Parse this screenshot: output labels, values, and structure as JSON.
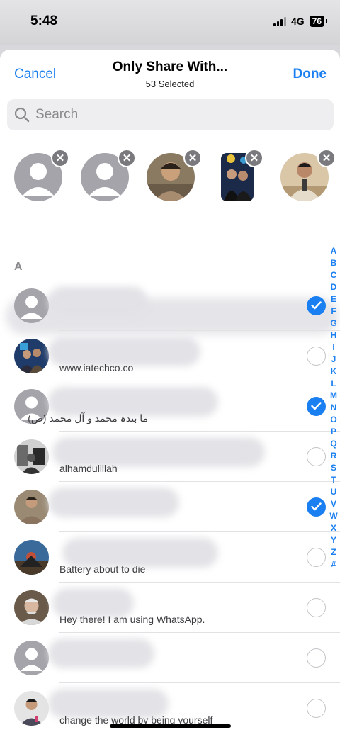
{
  "status_bar": {
    "time": "5:48",
    "network": "4G",
    "battery": "76"
  },
  "nav": {
    "cancel_label": "Cancel",
    "title": "Only Share With...",
    "subtitle": "53 Selected",
    "done_label": "Done"
  },
  "search": {
    "placeholder": "Search"
  },
  "selected_contacts": [
    {
      "avatar": "default-avatar"
    },
    {
      "avatar": "default-avatar"
    },
    {
      "avatar": "photo"
    },
    {
      "avatar": "photo"
    },
    {
      "avatar": "photo"
    }
  ],
  "section": {
    "letter": "A"
  },
  "contacts": [
    {
      "status": "",
      "selected": true
    },
    {
      "status": "www.iatechco.co",
      "selected": false
    },
    {
      "status": "ما بندہ محمد و آل محمد (ص)",
      "selected": true
    },
    {
      "status": "alhamdulillah",
      "selected": false
    },
    {
      "status": "",
      "selected": true
    },
    {
      "status": "Battery about to die",
      "selected": false
    },
    {
      "status": "Hey there! I am using WhatsApp.",
      "selected": false
    },
    {
      "status": "",
      "selected": false
    },
    {
      "status": "change the world by being yourself",
      "selected": false
    }
  ],
  "index_letters": [
    "A",
    "B",
    "C",
    "D",
    "E",
    "F",
    "G",
    "H",
    "I",
    "J",
    "K",
    "L",
    "M",
    "N",
    "O",
    "P",
    "Q",
    "R",
    "S",
    "T",
    "U",
    "V",
    "W",
    "X",
    "Y",
    "Z",
    "#"
  ],
  "colors": {
    "accent": "#1a7ff0",
    "avatar_gray": "#a4a4aa"
  }
}
